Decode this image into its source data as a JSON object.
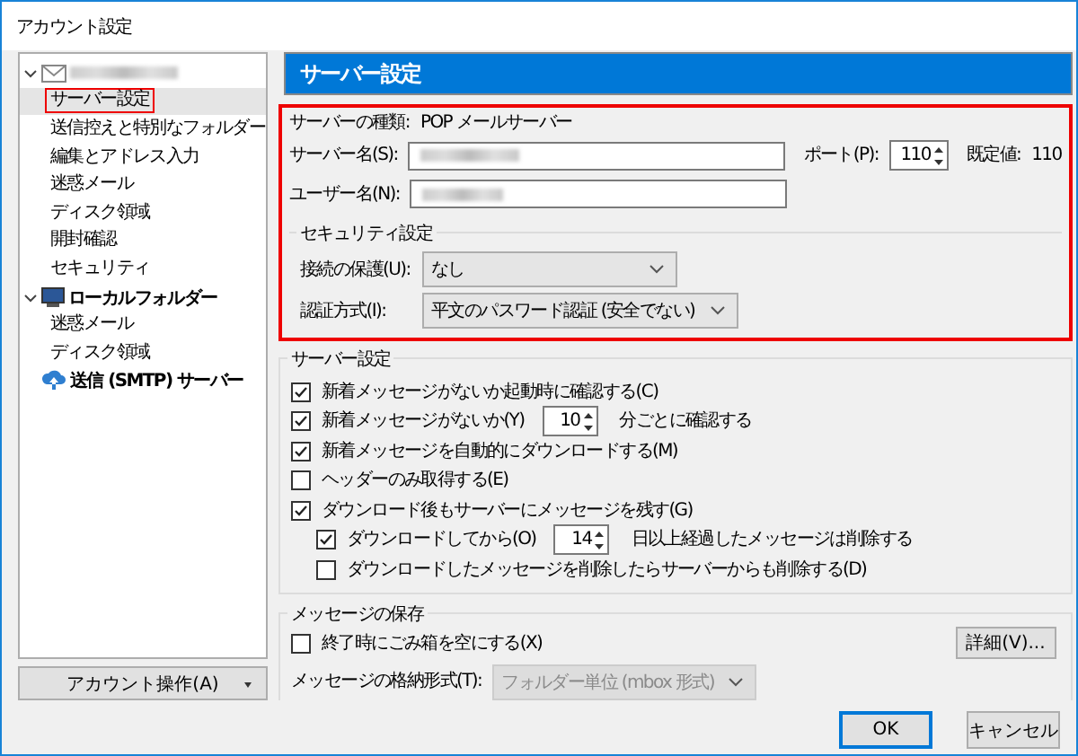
{
  "window": {
    "title": "アカウント設定"
  },
  "sidebar": {
    "tree": [
      {
        "kind": "mail-account",
        "expanded": true,
        "children": [
          {
            "label": "サーバー設定",
            "selected": true,
            "highlighted": true
          },
          {
            "label": "送信控えと特別なフォルダー",
            "selected": false,
            "highlighted": false
          },
          {
            "label": "編集とアドレス入力",
            "selected": false,
            "highlighted": false
          },
          {
            "label": "迷惑メール",
            "selected": false,
            "highlighted": false
          },
          {
            "label": "ディスク領域",
            "selected": false,
            "highlighted": false
          },
          {
            "label": "開封確認",
            "selected": false,
            "highlighted": false
          },
          {
            "label": "セキュリティ",
            "selected": false,
            "highlighted": false
          }
        ]
      },
      {
        "kind": "local-folders",
        "label": "ローカルフォルダー",
        "expanded": true,
        "children": [
          {
            "label": "迷惑メール",
            "selected": false,
            "highlighted": false
          },
          {
            "label": "ディスク領域",
            "selected": false,
            "highlighted": false
          }
        ]
      },
      {
        "kind": "smtp",
        "label": "送信 (SMTP) サーバー"
      }
    ],
    "account_actions_button": "アカウント操作(A)"
  },
  "panel": {
    "header": "サーバー設定",
    "highlighted": true,
    "server_type_label": "サーバーの種類:",
    "server_type": "POP メールサーバー",
    "server_name_label": "サーバー名(S):",
    "port_label": "ポート(P):",
    "port": "110",
    "default_label": "既定値:",
    "default_port": "110",
    "user_name_label": "ユーザー名(N):",
    "security": {
      "title": "セキュリティ設定",
      "connection_label": "接続の保護(U):",
      "connection": "なし",
      "auth_label": "認証方式(I):",
      "auth": "平文のパスワード認証 (安全でない)"
    }
  },
  "server_settings": {
    "title": "サーバー設定",
    "options": [
      {
        "kind": "check",
        "label": "新着メッセージがないか起動時に確認する(C)",
        "checked": true
      },
      {
        "kind": "check-spin",
        "label": "新着メッセージがないか(Y)",
        "checked": true,
        "value": "10",
        "suffix": "分ごとに確認する"
      },
      {
        "kind": "check",
        "label": "新着メッセージを自動的にダウンロードする(M)",
        "checked": true
      },
      {
        "kind": "check",
        "label": "ヘッダーのみ取得する(E)",
        "checked": false
      },
      {
        "kind": "check",
        "label": "ダウンロード後もサーバーにメッセージを残す(G)",
        "checked": true,
        "children": [
          {
            "kind": "check-spin",
            "label": "ダウンロードしてから(O)",
            "checked": true,
            "value": "14",
            "suffix": "日以上経過したメッセージは削除する"
          },
          {
            "kind": "check",
            "label": "ダウンロードしたメッセージを削除したらサーバーからも削除する(D)",
            "checked": false
          }
        ]
      }
    ]
  },
  "message_storage": {
    "title": "メッセージの保存",
    "empty_trash": {
      "label": "終了時にごみ箱を空にする(X)",
      "checked": false
    },
    "details_button": "詳細(V)...",
    "format_label": "メッセージの格納形式(T):",
    "format": "フォルダー単位 (mbox 形式)",
    "format_disabled": true
  },
  "buttons": [
    {
      "label": "OK",
      "default": true
    },
    {
      "label": "キャンセル",
      "default": false
    }
  ]
}
